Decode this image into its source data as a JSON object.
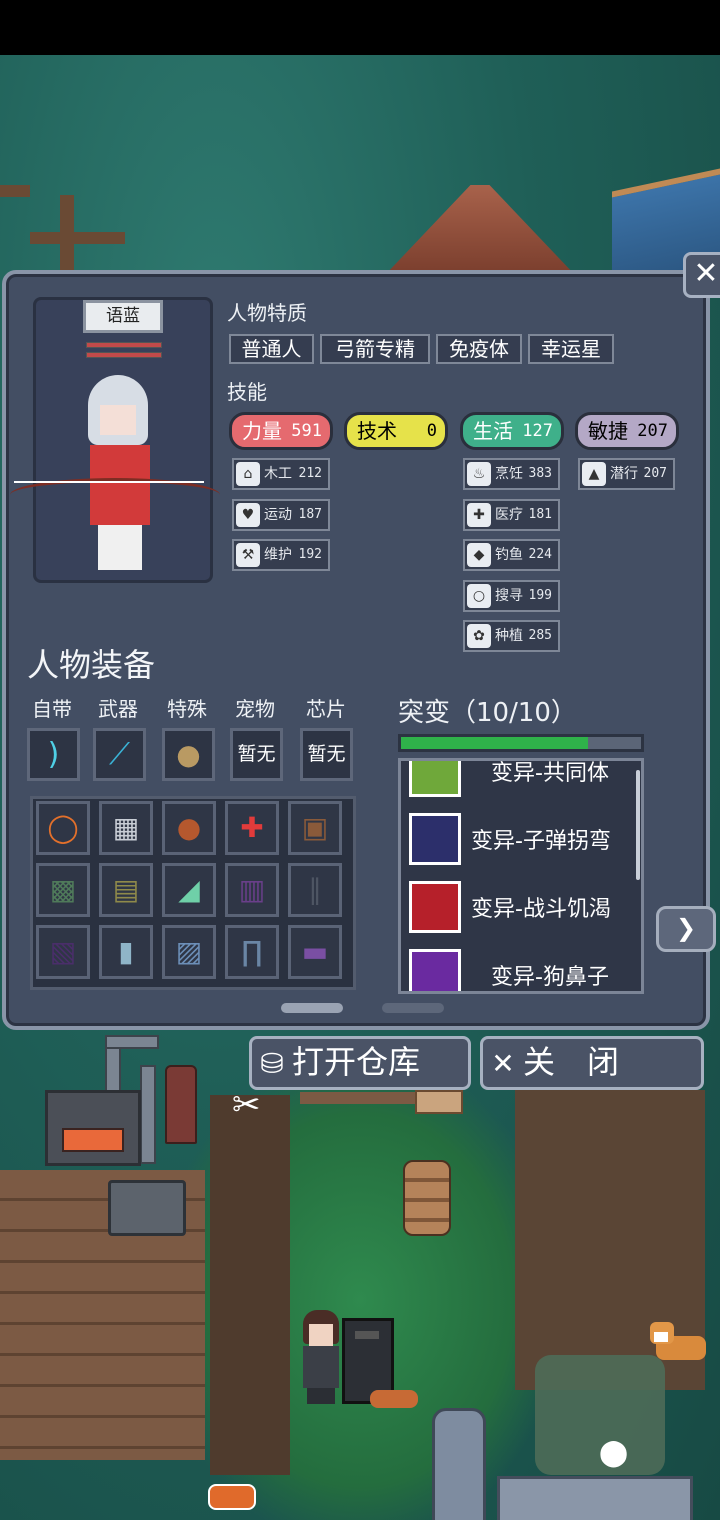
{
  "character": {
    "name": "语蓝"
  },
  "traits": {
    "title": "人物特质",
    "items": [
      "普通人",
      "弓箭专精",
      "免疫体",
      "幸运星"
    ]
  },
  "skills": {
    "title": "技能",
    "stats": [
      {
        "label": "力量",
        "value": "591",
        "color": "#e56a6f"
      },
      {
        "label": "技术",
        "value": "0",
        "color": "#e6e24a"
      },
      {
        "label": "生活",
        "value": "127",
        "color": "#3fb08a"
      },
      {
        "label": "敏捷",
        "value": "207",
        "color": "#b4a8c6"
      }
    ],
    "items": [
      {
        "icon": "house-icon",
        "label": "木工",
        "value": "212"
      },
      {
        "icon": "heart-icon",
        "label": "运动",
        "value": "187"
      },
      {
        "icon": "wrench-icon",
        "label": "维护",
        "value": "192"
      },
      {
        "icon": "pot-icon",
        "label": "烹饪",
        "value": "383"
      },
      {
        "icon": "medkit-icon",
        "label": "医疗",
        "value": "181"
      },
      {
        "icon": "fish-icon",
        "label": "钓鱼",
        "value": "224"
      },
      {
        "icon": "magnifier-icon",
        "label": "搜寻",
        "value": "199"
      },
      {
        "icon": "plant-icon",
        "label": "种植",
        "value": "285"
      },
      {
        "icon": "sneak-icon",
        "label": "潜行",
        "value": "207"
      }
    ]
  },
  "equipment": {
    "title": "人物装备",
    "slots": [
      {
        "label": "自带",
        "content": "",
        "icon": "bow-icon"
      },
      {
        "label": "武器",
        "content": "",
        "icon": "bow-weapon-icon"
      },
      {
        "label": "特殊",
        "content": "",
        "icon": "bag-icon"
      },
      {
        "label": "宠物",
        "content": "暂无",
        "icon": ""
      },
      {
        "label": "芯片",
        "content": "暂无",
        "icon": ""
      }
    ],
    "inventory_icons": [
      "ring-icon",
      "vest-icon",
      "pouch-icon",
      "medkit-icon",
      "backpack-icon",
      "camo-shirt-icon",
      "jacket-icon",
      "sneakers-icon",
      "armor-vest-icon",
      "pants-icon",
      "suit-icon",
      "boots-icon",
      "shirt-icon",
      "jeans-icon",
      "shoes-icon"
    ]
  },
  "mutation": {
    "title": "突变（10/10）",
    "progress": 0.78,
    "items": [
      {
        "label": "变异-共同体",
        "icon": "community-icon",
        "color": "#6fa83a"
      },
      {
        "label": "变异-子弹拐弯",
        "icon": "curve-bullet-icon",
        "color": "#2c2f6b"
      },
      {
        "label": "变异-战斗饥渴",
        "icon": "fist-icon",
        "color": "#b6202a"
      },
      {
        "label": "变异-狗鼻子",
        "icon": "nose-icon",
        "color": "#6a2aa0"
      }
    ]
  },
  "actions": {
    "open_storage": "打开仓库",
    "close": "关　闭"
  }
}
